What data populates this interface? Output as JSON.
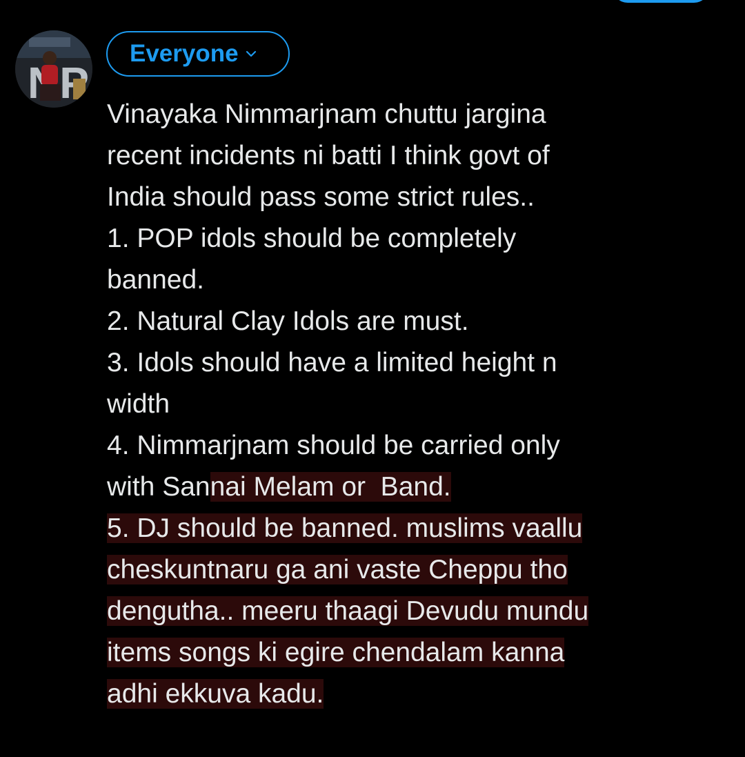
{
  "compose": {
    "audience_label": "Everyone",
    "chevron_icon": "chevron-down-icon",
    "avatar_icon": "user-avatar-image",
    "accent_color": "#1d9bf0",
    "text_color": "#e7e9ea",
    "highlight_color": "#2c0a0a"
  },
  "tweet": {
    "lines": [
      {
        "pre": "Vinayaka Nimmarjnam chuttu jargina",
        "hl": ""
      },
      {
        "pre": "recent incidents ni batti I think govt of",
        "hl": ""
      },
      {
        "pre": "India should pass some strict rules..",
        "hl": ""
      },
      {
        "pre": "1. POP idols should be completely",
        "hl": ""
      },
      {
        "pre": "banned.",
        "hl": ""
      },
      {
        "pre": "2. Natural Clay Idols are must.",
        "hl": ""
      },
      {
        "pre": "3. Idols should have a limited height n",
        "hl": ""
      },
      {
        "pre": "width",
        "hl": ""
      },
      {
        "pre": "4. Nimmarjnam should be carried only",
        "hl": ""
      },
      {
        "pre": "with San",
        "hl": "nai Melam or  Band."
      },
      {
        "pre": "",
        "hl": "5. DJ should be banned. muslims vaallu"
      },
      {
        "pre": "",
        "hl": "cheskuntnaru ga ani vaste Cheppu tho"
      },
      {
        "pre": "",
        "hl": "dengutha.. meeru thaagi Devudu mundu"
      },
      {
        "pre": "",
        "hl": "items songs ki egire chendalam kanna"
      },
      {
        "pre": "",
        "hl": "adhi ekkuva kadu."
      }
    ]
  }
}
